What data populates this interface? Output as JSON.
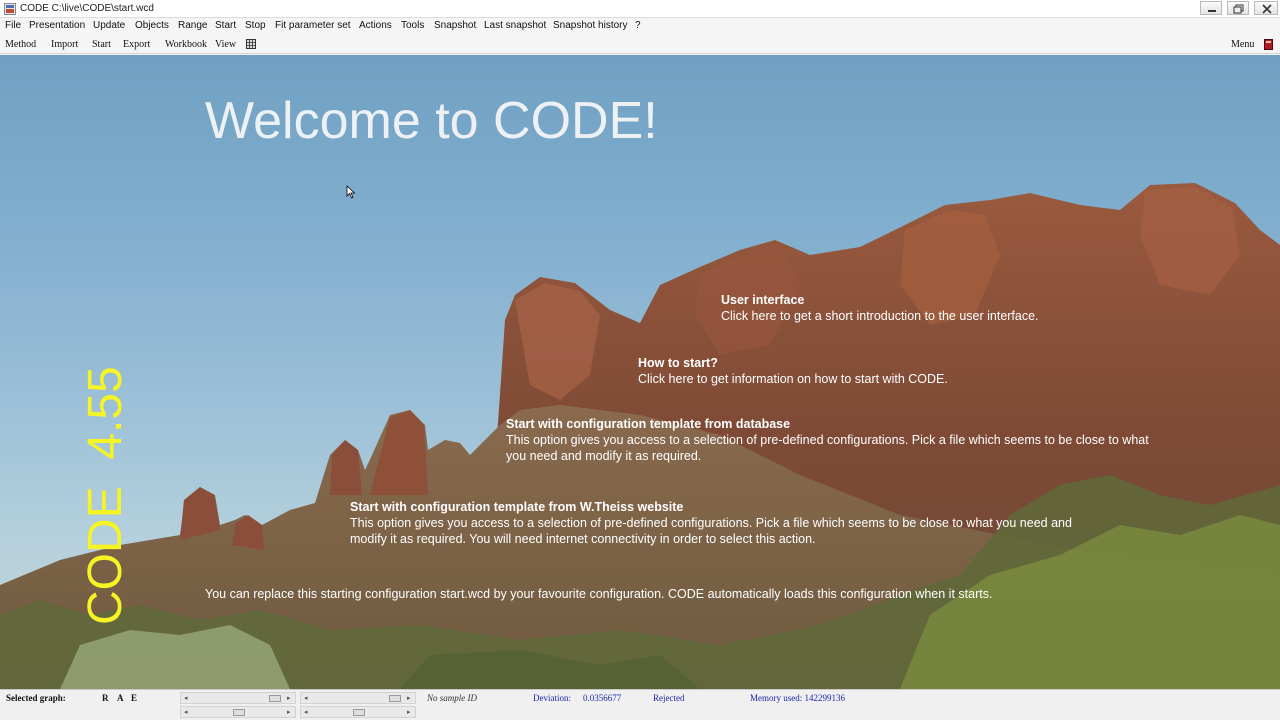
{
  "window": {
    "title": "CODE C:\\live\\CODE\\start.wcd"
  },
  "menu": [
    "File",
    "Presentation",
    "Update",
    "Objects",
    "Range",
    "Start",
    "Stop",
    "Fit parameter set",
    "Actions",
    "Tools",
    "Snapshot",
    "Last snapshot",
    "Snapshot history",
    "?"
  ],
  "toolbar": {
    "items": [
      "Method",
      "Import",
      "Start",
      "Export",
      "Workbook",
      "View"
    ],
    "menu_label": "Menu"
  },
  "main": {
    "welcome": "Welcome to CODE!",
    "version": "CODE  4.55",
    "options": [
      {
        "title": "User interface",
        "text": "Click here to get a short introduction to the user interface."
      },
      {
        "title": "How to start?",
        "text": "Click here to get information on how to start with CODE."
      },
      {
        "title": "Start with configuration template from database",
        "text": "This option gives you access to a selection of pre-defined configurations. Pick a file which seems to be close to what you need and modify it as required."
      },
      {
        "title": "Start with configuration template from W.Theiss website",
        "text": "This option gives you access to a selection of pre-defined configurations. Pick a file which seems to be close to what you need and modify it as required. You will need internet connectivity in order to select this action."
      }
    ],
    "note": "You can replace this starting configuration start.wcd by your favourite configuration. CODE automatically loads this configuration when it starts."
  },
  "status": {
    "selected_graph": "Selected graph:",
    "rae": [
      "R",
      "A",
      "E"
    ],
    "sample": "No sample ID",
    "deviation_label": "Deviation:",
    "deviation_value": "0.0356677",
    "fit_state": "Rejected",
    "memory": "Memory used: 142299136"
  },
  "colors": {
    "version_text": "#f6f425",
    "status_blue": "#1b27a8"
  }
}
